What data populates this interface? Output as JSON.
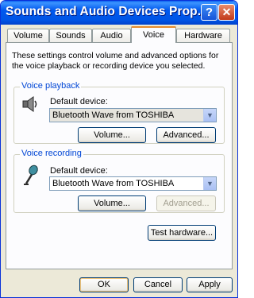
{
  "window": {
    "title": "Sounds and Audio Devices Prop...",
    "help_label": "?",
    "close_label": "✕"
  },
  "tabs": [
    {
      "label": "Volume",
      "active": false
    },
    {
      "label": "Sounds",
      "active": false
    },
    {
      "label": "Audio",
      "active": false
    },
    {
      "label": "Voice",
      "active": true
    },
    {
      "label": "Hardware",
      "active": false
    }
  ],
  "description": "These settings control volume and advanced options for the voice playback or recording device you selected.",
  "playback": {
    "group_title": "Voice playback",
    "device_label": "Default device:",
    "device_value": "Bluetooth Wave from TOSHIBA",
    "volume_button": "Volume...",
    "advanced_button": "Advanced...",
    "icon": "speaker-icon"
  },
  "recording": {
    "group_title": "Voice recording",
    "device_label": "Default device:",
    "device_value": "Bluetooth Wave from TOSHIBA",
    "volume_button": "Volume...",
    "advanced_button": "Advanced...",
    "advanced_enabled": false,
    "icon": "microphone-icon"
  },
  "test_hardware_button": "Test hardware...",
  "footer": {
    "ok": "OK",
    "cancel": "Cancel",
    "apply": "Apply"
  },
  "colors": {
    "title_bar": "#0055E6",
    "group_title": "#0046D5",
    "active_tab_highlight": "#E68B2C"
  }
}
